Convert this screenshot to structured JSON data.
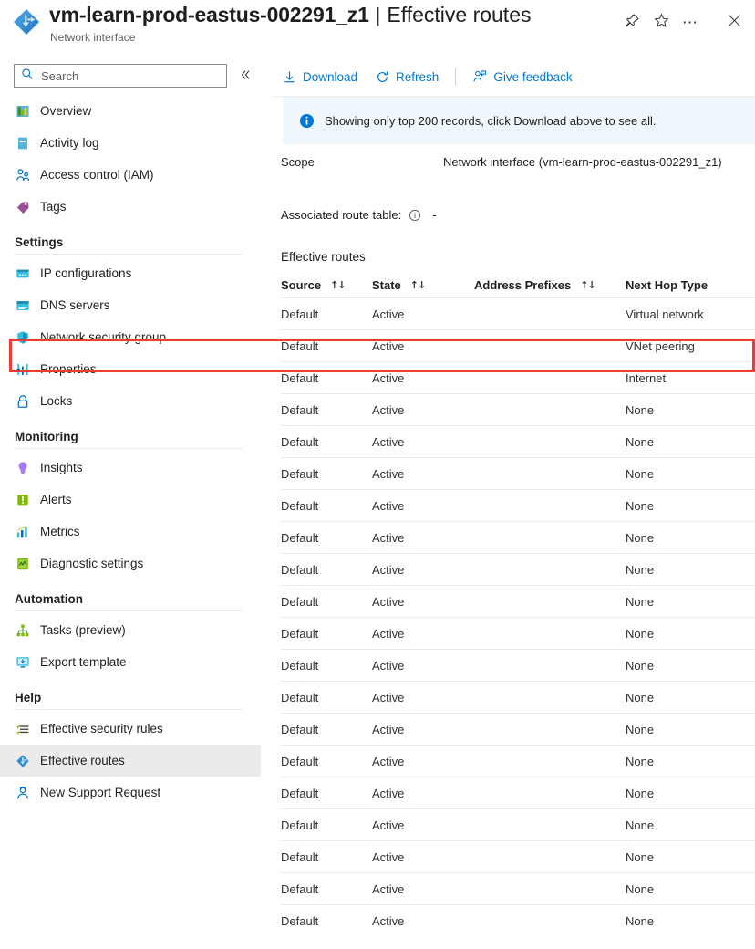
{
  "header": {
    "resource_icon": "network-interface-icon",
    "title": "vm-learn-prod-eastus-002291_z1",
    "separator": "|",
    "section": "Effective routes",
    "subtitle": "Network interface",
    "actions": [
      {
        "name": "pin-icon",
        "label": "Pin"
      },
      {
        "name": "favorite-star-icon",
        "label": "Favorite"
      },
      {
        "name": "more-ellipsis-icon",
        "label": "More"
      },
      {
        "name": "close-icon",
        "label": "Close"
      }
    ]
  },
  "sidebar": {
    "search": {
      "placeholder": "Search",
      "value": "",
      "icon": "search-icon"
    },
    "collapse": {
      "icon": "chevron-double-left-icon",
      "label": "Collapse"
    },
    "top_items": [
      {
        "label": "Overview",
        "icon": "overview-icon",
        "selected": false
      },
      {
        "label": "Activity log",
        "icon": "activity-log-icon",
        "selected": false
      },
      {
        "label": "Access control (IAM)",
        "icon": "access-control-icon",
        "selected": false
      },
      {
        "label": "Tags",
        "icon": "tags-icon",
        "selected": false
      }
    ],
    "groups": [
      {
        "title": "Settings",
        "items": [
          {
            "label": "IP configurations",
            "icon": "ip-configurations-icon",
            "selected": false
          },
          {
            "label": "DNS servers",
            "icon": "dns-servers-icon",
            "selected": false
          },
          {
            "label": "Network security group",
            "icon": "shield-icon",
            "selected": false
          },
          {
            "label": "Properties",
            "icon": "properties-icon",
            "selected": false
          },
          {
            "label": "Locks",
            "icon": "lock-icon",
            "selected": false
          }
        ]
      },
      {
        "title": "Monitoring",
        "items": [
          {
            "label": "Insights",
            "icon": "insights-lightbulb-icon",
            "selected": false
          },
          {
            "label": "Alerts",
            "icon": "alerts-icon",
            "selected": false
          },
          {
            "label": "Metrics",
            "icon": "metrics-chart-icon",
            "selected": false
          },
          {
            "label": "Diagnostic settings",
            "icon": "diagnostic-settings-icon",
            "selected": false
          }
        ]
      },
      {
        "title": "Automation",
        "items": [
          {
            "label": "Tasks (preview)",
            "icon": "tasks-icon",
            "selected": false
          },
          {
            "label": "Export template",
            "icon": "export-template-icon",
            "selected": false
          }
        ]
      },
      {
        "title": "Help",
        "items": [
          {
            "label": "Effective security rules",
            "icon": "effective-security-rules-icon",
            "selected": false
          },
          {
            "label": "Effective routes",
            "icon": "effective-routes-icon",
            "selected": true
          },
          {
            "label": "New Support Request",
            "icon": "support-request-icon",
            "selected": false
          }
        ]
      }
    ]
  },
  "toolbar": {
    "download_label": "Download",
    "refresh_label": "Refresh",
    "feedback_label": "Give feedback"
  },
  "info_banner": {
    "icon": "info-circle-icon",
    "text": "Showing only top 200 records, click Download above to see all.",
    "background": "#eff6fc",
    "accent": "#0078d4"
  },
  "scope": {
    "label": "Scope",
    "value": "Network interface (vm-learn-prod-eastus-002291_z1)"
  },
  "associated_route_table": {
    "label": "Associated route table:",
    "info_icon": "info-circle-outline-icon",
    "value": "-"
  },
  "table": {
    "caption": "Effective routes",
    "columns": [
      {
        "label": "Source",
        "sortable": true,
        "sort_icon": "sort-arrows-icon"
      },
      {
        "label": "State",
        "sortable": true,
        "sort_icon": "sort-arrows-icon"
      },
      {
        "label": "Address Prefixes",
        "sortable": true,
        "sort_icon": "sort-arrows-icon"
      },
      {
        "label": "Next Hop Type",
        "sortable": false,
        "sort_icon": ""
      }
    ],
    "rows": [
      {
        "source": "Default",
        "state": "Active",
        "address_prefixes": "",
        "next_hop_type": "Virtual network",
        "highlighted": false
      },
      {
        "source": "Default",
        "state": "Active",
        "address_prefixes": "",
        "next_hop_type": "VNet peering",
        "highlighted": true
      },
      {
        "source": "Default",
        "state": "Active",
        "address_prefixes": "",
        "next_hop_type": "Internet",
        "highlighted": false
      },
      {
        "source": "Default",
        "state": "Active",
        "address_prefixes": "",
        "next_hop_type": "None",
        "highlighted": false
      },
      {
        "source": "Default",
        "state": "Active",
        "address_prefixes": "",
        "next_hop_type": "None",
        "highlighted": false
      },
      {
        "source": "Default",
        "state": "Active",
        "address_prefixes": "",
        "next_hop_type": "None",
        "highlighted": false
      },
      {
        "source": "Default",
        "state": "Active",
        "address_prefixes": "",
        "next_hop_type": "None",
        "highlighted": false
      },
      {
        "source": "Default",
        "state": "Active",
        "address_prefixes": "",
        "next_hop_type": "None",
        "highlighted": false
      },
      {
        "source": "Default",
        "state": "Active",
        "address_prefixes": "",
        "next_hop_type": "None",
        "highlighted": false
      },
      {
        "source": "Default",
        "state": "Active",
        "address_prefixes": "",
        "next_hop_type": "None",
        "highlighted": false
      },
      {
        "source": "Default",
        "state": "Active",
        "address_prefixes": "",
        "next_hop_type": "None",
        "highlighted": false
      },
      {
        "source": "Default",
        "state": "Active",
        "address_prefixes": "",
        "next_hop_type": "None",
        "highlighted": false
      },
      {
        "source": "Default",
        "state": "Active",
        "address_prefixes": "",
        "next_hop_type": "None",
        "highlighted": false
      },
      {
        "source": "Default",
        "state": "Active",
        "address_prefixes": "",
        "next_hop_type": "None",
        "highlighted": false
      },
      {
        "source": "Default",
        "state": "Active",
        "address_prefixes": "",
        "next_hop_type": "None",
        "highlighted": false
      },
      {
        "source": "Default",
        "state": "Active",
        "address_prefixes": "",
        "next_hop_type": "None",
        "highlighted": false
      },
      {
        "source": "Default",
        "state": "Active",
        "address_prefixes": "",
        "next_hop_type": "None",
        "highlighted": false
      },
      {
        "source": "Default",
        "state": "Active",
        "address_prefixes": "",
        "next_hop_type": "None",
        "highlighted": false
      },
      {
        "source": "Default",
        "state": "Active",
        "address_prefixes": "",
        "next_hop_type": "None",
        "highlighted": false
      },
      {
        "source": "Default",
        "state": "Active",
        "address_prefixes": "",
        "next_hop_type": "None",
        "highlighted": false
      }
    ]
  },
  "annotation": {
    "highlight_color": "#ef3b36",
    "target_row_index": 1
  },
  "colors": {
    "accent": "#0078d4",
    "text": "#201f1e",
    "muted": "#605e5c",
    "divider": "#edebe9",
    "selected_bg": "#edebe9"
  }
}
